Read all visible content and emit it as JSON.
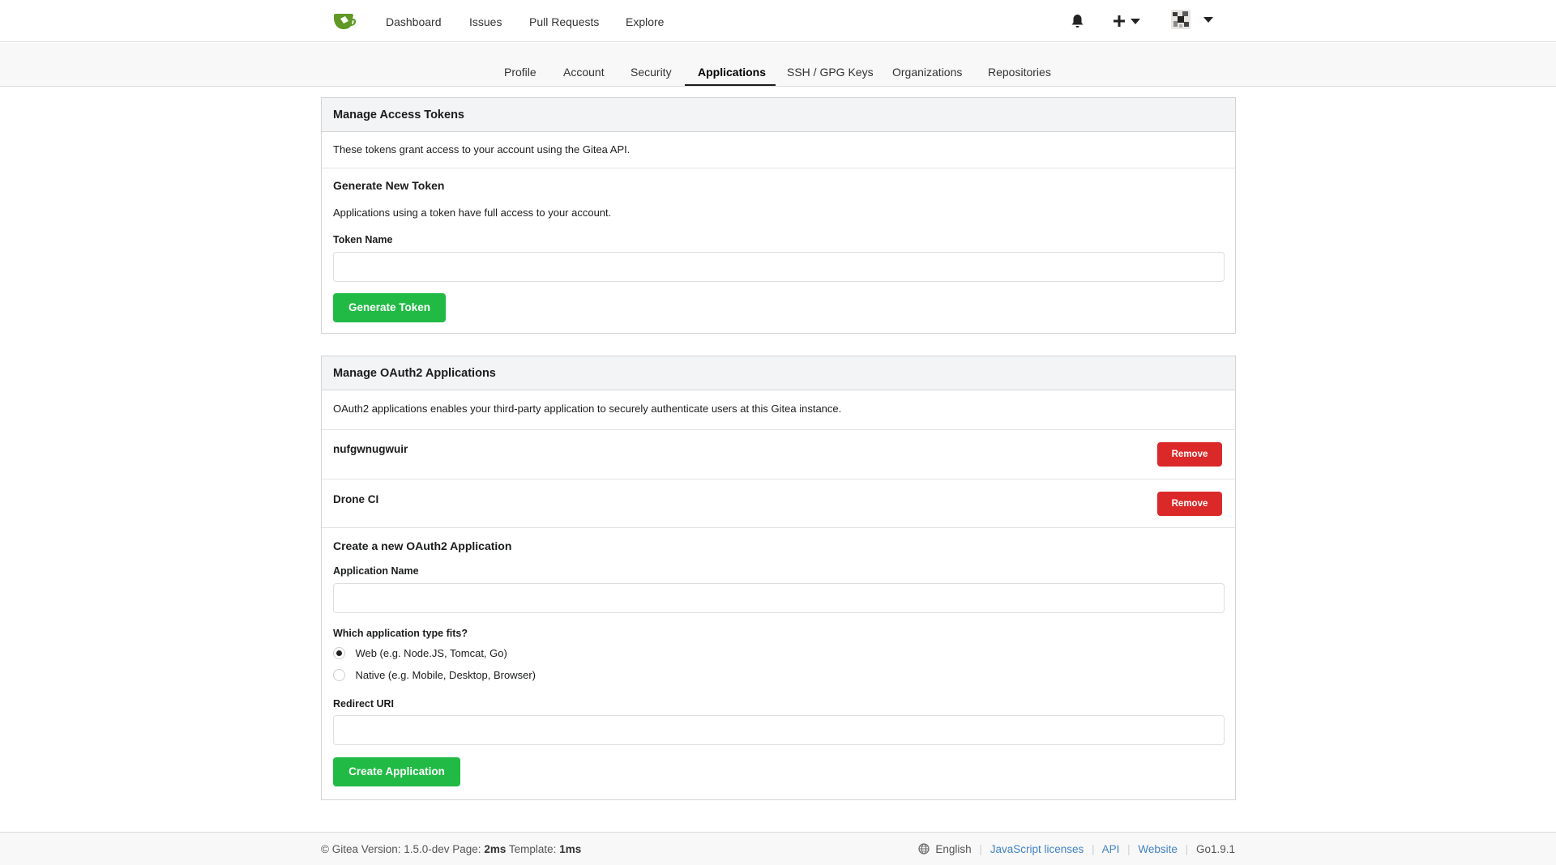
{
  "nav": {
    "items": [
      "Dashboard",
      "Issues",
      "Pull Requests",
      "Explore"
    ],
    "notifications_icon": "bell-icon",
    "create_icon": "plus-icon"
  },
  "tabs": {
    "items": [
      "Profile",
      "Account",
      "Security",
      "Applications",
      "SSH / GPG Keys",
      "Organizations",
      "Repositories"
    ],
    "active": "Applications"
  },
  "tokens": {
    "header": "Manage Access Tokens",
    "description": "These tokens grant access to your account using the Gitea API.",
    "generate_title": "Generate New Token",
    "generate_desc": "Applications using a token have full access to your account.",
    "token_name_label": "Token Name",
    "token_name_value": "",
    "generate_button": "Generate Token"
  },
  "oauth": {
    "header": "Manage OAuth2 Applications",
    "description": "OAuth2 applications enables your third-party application to securely authenticate users at this Gitea instance.",
    "apps": [
      {
        "name": "nufgwnugwuir",
        "remove": "Remove"
      },
      {
        "name": "Drone CI",
        "remove": "Remove"
      }
    ],
    "create_title": "Create a new OAuth2 Application",
    "app_name_label": "Application Name",
    "app_name_value": "",
    "type_label": "Which application type fits?",
    "type_options": [
      "Web (e.g. Node.JS, Tomcat, Go)",
      "Native (e.g. Mobile, Desktop, Browser)"
    ],
    "type_selected": "Web (e.g. Node.JS, Tomcat, Go)",
    "redirect_label": "Redirect URI",
    "redirect_value": "",
    "create_button": "Create Application"
  },
  "footer": {
    "copyright": "© Gitea Version: 1.5.0-dev Page:",
    "page_time": "2ms",
    "template_label": "Template:",
    "template_time": "1ms",
    "language": "English",
    "links": [
      "JavaScript licenses",
      "API",
      "Website"
    ],
    "go_version": "Go1.9.1"
  },
  "colors": {
    "primary_green": "#21ba45",
    "danger_red": "#db2828",
    "link_blue": "#4183c4",
    "logo_green": "#609926"
  }
}
